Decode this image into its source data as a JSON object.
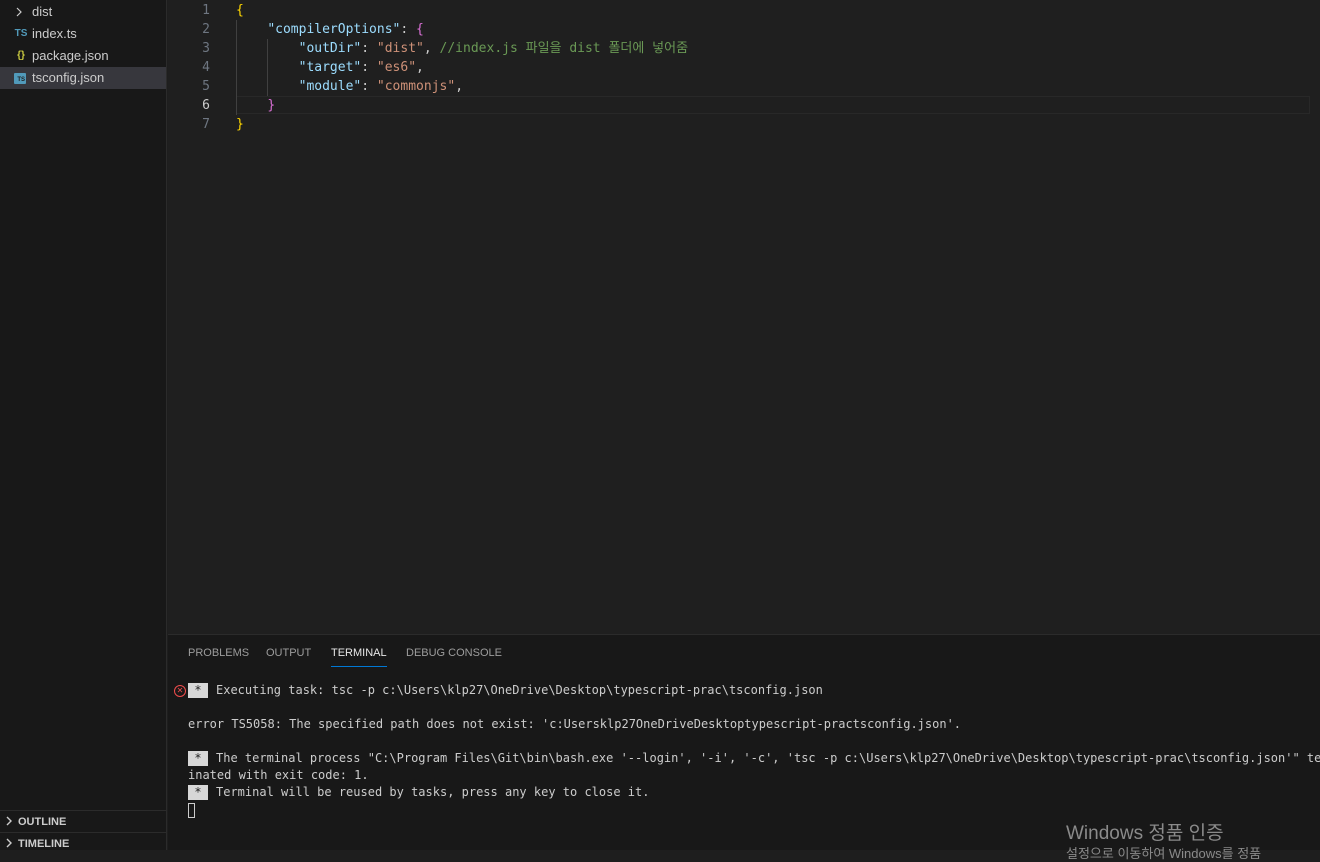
{
  "explorer": {
    "items": [
      {
        "label": "dist",
        "kind": "folder",
        "icon": "chevron-right-icon"
      },
      {
        "label": "index.ts",
        "kind": "file",
        "icon": "typescript-file-icon",
        "icon_text": "TS"
      },
      {
        "label": "package.json",
        "kind": "file",
        "icon": "json-file-icon",
        "icon_text": "{}"
      },
      {
        "label": "tsconfig.json",
        "kind": "file",
        "icon": "tsconfig-file-icon",
        "icon_text": "TS",
        "selected": true
      }
    ],
    "outline_label": "OUTLINE",
    "timeline_label": "TIMELINE"
  },
  "editor": {
    "current_line": 6,
    "line_numbers": [
      "1",
      "2",
      "3",
      "4",
      "5",
      "6",
      "7"
    ],
    "lines": [
      {
        "tokens": [
          {
            "t": "{",
            "c": "b1"
          }
        ]
      },
      {
        "tokens": [
          {
            "t": "    "
          },
          {
            "t": "\"compilerOptions\"",
            "c": "key"
          },
          {
            "t": ": ",
            "c": "pn"
          },
          {
            "t": "{",
            "c": "b2"
          }
        ]
      },
      {
        "tokens": [
          {
            "t": "        "
          },
          {
            "t": "\"outDir\"",
            "c": "key"
          },
          {
            "t": ": ",
            "c": "pn"
          },
          {
            "t": "\"dist\"",
            "c": "str"
          },
          {
            "t": ", ",
            "c": "pn"
          },
          {
            "t": "//index.js 파일을 dist 폴더에 넣어줌",
            "c": "cmt"
          }
        ]
      },
      {
        "tokens": [
          {
            "t": "        "
          },
          {
            "t": "\"target\"",
            "c": "key"
          },
          {
            "t": ": ",
            "c": "pn"
          },
          {
            "t": "\"es6\"",
            "c": "str"
          },
          {
            "t": ",",
            "c": "pn"
          }
        ]
      },
      {
        "tokens": [
          {
            "t": "        "
          },
          {
            "t": "\"module\"",
            "c": "key"
          },
          {
            "t": ": ",
            "c": "pn"
          },
          {
            "t": "\"commonjs\"",
            "c": "str"
          },
          {
            "t": ",",
            "c": "pn"
          }
        ]
      },
      {
        "tokens": [
          {
            "t": "    "
          },
          {
            "t": "}",
            "c": "b2"
          }
        ]
      },
      {
        "tokens": [
          {
            "t": "}",
            "c": "b1"
          }
        ]
      }
    ]
  },
  "panel": {
    "tabs": [
      {
        "label": "PROBLEMS",
        "active": false
      },
      {
        "label": "OUTPUT",
        "active": false
      },
      {
        "label": "TERMINAL",
        "active": true
      },
      {
        "label": "DEBUG CONSOLE",
        "active": false
      }
    ],
    "terminal": {
      "star": "*",
      "executing": "Executing task: tsc -p c:\\Users\\klp27\\OneDrive\\Desktop\\typescript-prac\\tsconfig.json",
      "error": "error TS5058: The specified path does not exist: 'c:Usersklp27OneDriveDesktoptypescript-practsconfig.json'.",
      "process_line1": "The terminal process \"C:\\Program Files\\Git\\bin\\bash.exe '--login', '-i', '-c', 'tsc -p c:\\Users\\klp27\\OneDrive\\Desktop\\typescript-prac\\tsconfig.json'\" term",
      "process_line2": "inated with exit code: 1.",
      "reuse": "Terminal will be reused by tasks, press any key to close it."
    }
  },
  "watermark": {
    "title": "Windows 정품 인증",
    "subtitle": "설정으로 이동하여 Windows를 정품"
  }
}
